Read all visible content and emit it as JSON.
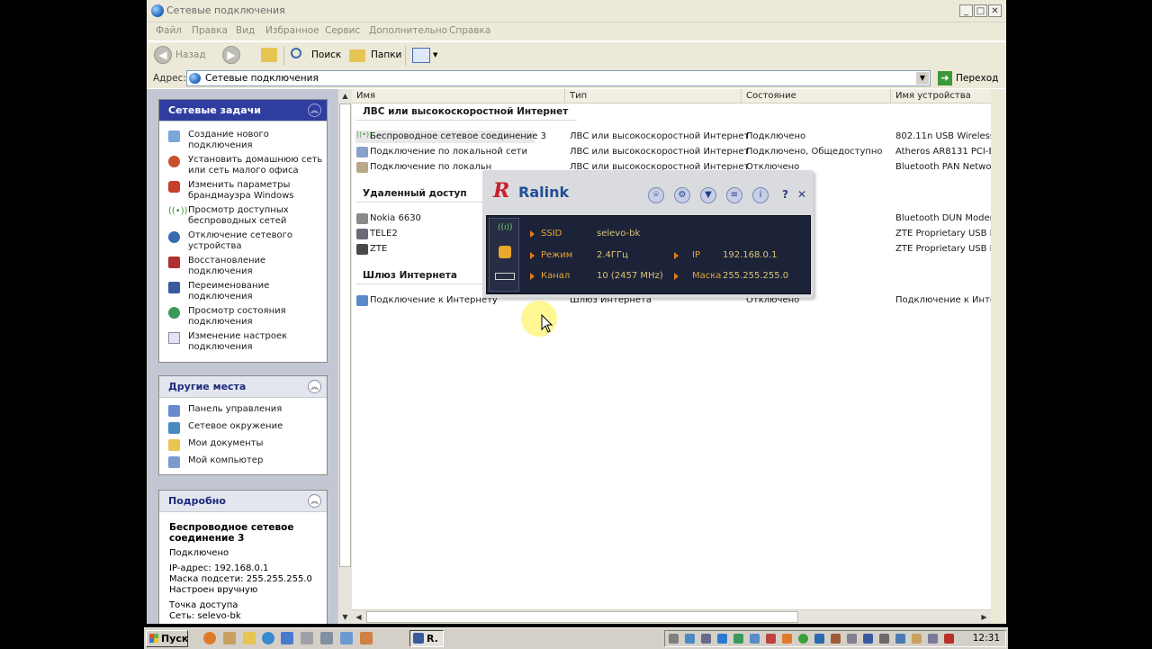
{
  "window": {
    "title": "Сетевые подключения"
  },
  "menu": [
    "Файл",
    "Правка",
    "Вид",
    "Избранное",
    "Сервис",
    "Дополнительно",
    "Справка"
  ],
  "toolbar": {
    "back": "Назад",
    "search": "Поиск",
    "folders": "Папки"
  },
  "address": {
    "label": "Адрес:",
    "value": "Сетевые подключения",
    "go": "Переход"
  },
  "tasks": {
    "header": "Сетевые задачи",
    "items": [
      "Создание нового подключения",
      "Установить домашнюю сеть или сеть малого офиса",
      "Изменить параметры брандмауэра Windows",
      "Просмотр доступных беспроводных сетей",
      "Отключение сетевого устройства",
      "Восстановление подключения",
      "Переименование подключения",
      "Просмотр состояния подключения",
      "Изменение настроек подключения"
    ]
  },
  "other_places": {
    "header": "Другие места",
    "items": [
      "Панель управления",
      "Сетевое окружение",
      "Мои документы",
      "Мой компьютер"
    ]
  },
  "details": {
    "header": "Подробно",
    "name": "Беспроводное сетевое соединение 3",
    "status": "Подключено",
    "ip": "IP-адрес: 192.168.0.1",
    "mask": "Маска подсети: 255.255.255.0",
    "config": "Настроен вручную",
    "ap_label": "Точка доступа",
    "ssid": "Сеть: selevo-bk"
  },
  "columns": [
    "Имя",
    "Тип",
    "Состояние",
    "Имя устройства"
  ],
  "groups": {
    "lan": "ЛВС или высокоскоростной Интернет",
    "remote": "Удаленный доступ",
    "gateway": "Шлюз Интернета"
  },
  "rows": {
    "lan": [
      {
        "name": "Беспроводное сетевое соединение 3",
        "type": "ЛВС или высокоскоростной Интернет",
        "state": "Подключено",
        "device": "802.11n USB Wireless LAN"
      },
      {
        "name": "Подключение по локальной сети",
        "type": "ЛВС или высокоскоростной Интернет",
        "state": "Подключено, Общедоступно",
        "device": "Atheros AR8131 PCI-E Gig"
      },
      {
        "name": "Подключение по локальн",
        "type": "ЛВС или высокоскоростной Интернет",
        "state": "Отключено",
        "device": "Bluetooth PAN Network Ad"
      }
    ],
    "remote": [
      {
        "name": "Nokia 6630",
        "device": "Bluetooth DUN Modem"
      },
      {
        "name": "TELE2",
        "device": "ZTE Proprietary USB Moder"
      },
      {
        "name": "ZTE",
        "device": "ZTE Proprietary USB Moder"
      }
    ],
    "gateway": [
      {
        "name": "Подключение к Интернету",
        "type": "Шлюз Интернета",
        "state": "Отключено",
        "device": "Подключение к Интернет"
      }
    ]
  },
  "ralink": {
    "brand": "Ralink",
    "ssid_label": "SSID",
    "ssid": "selevo-bk",
    "mode_label": "Режим",
    "mode": "2.4ГГц",
    "channel_label": "Канал",
    "channel": "10 (2457 MHz)",
    "ip_label": "IP",
    "ip": "192.168.0.1",
    "mask_label": "Маска",
    "mask": "255.255.255.0"
  },
  "taskbar": {
    "start": "Пуск",
    "task_label": "R.",
    "clock": "12:31"
  },
  "colors": {
    "task_header": "#2f3e9e",
    "ralink_panel": "#1c2338",
    "ralink_value": "#d8c476",
    "ralink_label": "#e3a534"
  }
}
